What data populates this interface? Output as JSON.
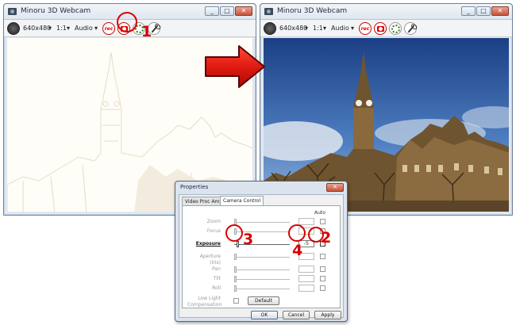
{
  "left_window": {
    "title": "Minoru 3D Webcam",
    "toolbar": {
      "resolution": "640x480",
      "ratio": "1:1",
      "audio": "Audio",
      "rec": "rec"
    }
  },
  "right_window": {
    "title": "Minoru 3D Webcam",
    "toolbar": {
      "resolution": "640x480",
      "ratio": "1:1",
      "audio": "Audio",
      "rec": "rec"
    }
  },
  "dialog": {
    "title": "Properties",
    "close": "✕",
    "tabs": [
      "Video Proc Amp",
      "Camera Control"
    ],
    "auto_label": "Auto",
    "rows": [
      {
        "label": "Zoom",
        "value": "",
        "fill": 0.0
      },
      {
        "label": "Focus",
        "value": "",
        "fill": 0.0
      },
      {
        "label": "Exposure",
        "value": "-5",
        "fill": 0.05
      },
      {
        "label": "Aperture (Iris)",
        "value": "",
        "fill": 0.0
      },
      {
        "label": "Pan",
        "value": "",
        "fill": 0.0
      },
      {
        "label": "Tilt",
        "value": "",
        "fill": 0.0
      },
      {
        "label": "Roll",
        "value": "",
        "fill": 0.0
      }
    ],
    "low_light": "Low Light Compensation",
    "default_button": "Default",
    "ok": "OK",
    "cancel": "Cancel",
    "apply": "Apply"
  },
  "annotations": [
    "1",
    "2",
    "3",
    "4"
  ]
}
